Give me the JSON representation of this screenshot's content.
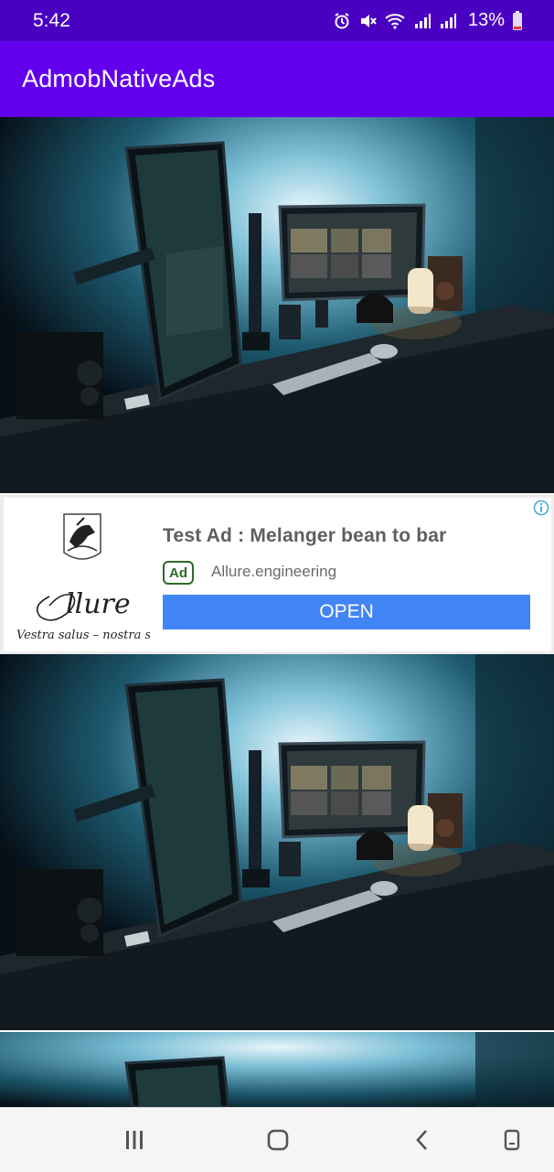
{
  "status_bar": {
    "time": "5:42",
    "battery": "13%",
    "icons": [
      "alarm-icon",
      "mute-icon",
      "wifi-icon",
      "signal-icon",
      "signal-icon",
      "battery-icon"
    ]
  },
  "app_bar": {
    "title": "AdmobNativeAds",
    "color": "#6200ee"
  },
  "photos": [
    {
      "name": "desk-setup-photo"
    },
    {
      "name": "desk-setup-photo"
    },
    {
      "name": "desk-setup-photo"
    }
  ],
  "ad": {
    "headline": "Test Ad : Melanger bean to bar",
    "badge": "Ad",
    "advertiser": "Allure.engineering",
    "cta": "OPEN",
    "cta_color": "#4285f4",
    "logo": {
      "brand": "Allure",
      "motto": "Vestra salus – nostra sal"
    }
  },
  "nav_bar": {
    "buttons": [
      "recents-button",
      "home-button",
      "back-button",
      "rotate-button"
    ]
  }
}
